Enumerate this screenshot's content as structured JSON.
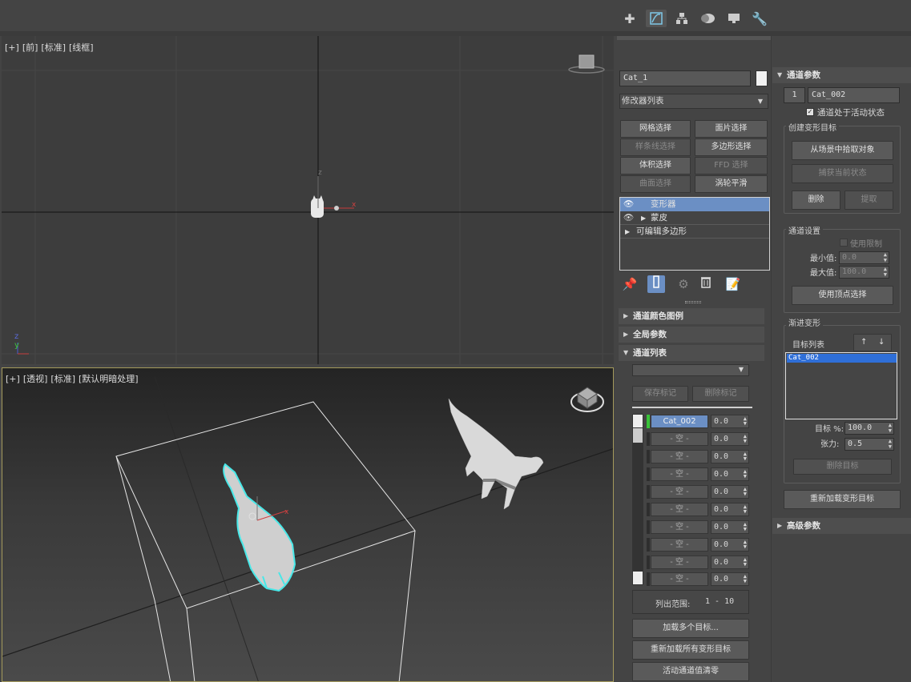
{
  "viewports": {
    "front": {
      "plus": "[+]",
      "view": "[前]",
      "shading": "[标准]",
      "display": "[线框]"
    },
    "perspective": {
      "plus": "[+]",
      "view": "[透视]",
      "shading": "[标准]",
      "display": "[默认明暗处理]"
    },
    "axis": {
      "x": "x",
      "y": "y",
      "z": "z"
    }
  },
  "cmd_panel": {
    "tabs": [
      "create-icon",
      "modify-icon",
      "hierarchy-icon",
      "motion-icon",
      "display-icon",
      "utilities-icon"
    ],
    "object_name": "Cat_1",
    "modifier_list": "修改器列表",
    "modifier_buttons": [
      {
        "label": "网格选择",
        "enabled": true
      },
      {
        "label": "面片选择",
        "enabled": true
      },
      {
        "label": "样条线选择",
        "enabled": false
      },
      {
        "label": "多边形选择",
        "enabled": true
      },
      {
        "label": "体积选择",
        "enabled": true
      },
      {
        "label": "FFD 选择",
        "enabled": false
      },
      {
        "label": "曲面选择",
        "enabled": false
      },
      {
        "label": "涡轮平滑",
        "enabled": true
      }
    ],
    "stack": [
      {
        "label": "变形器",
        "selected": true,
        "eye": true,
        "expand": false
      },
      {
        "label": "蒙皮",
        "selected": false,
        "eye": true,
        "expand": true
      },
      {
        "label": "可编辑多边形",
        "selected": false,
        "eye": false,
        "expand": true
      }
    ]
  },
  "sections": {
    "channel_color_legend": "通道颜色图例",
    "global_params": "全局参数",
    "channel_list": "通道列表",
    "channel_params": "通道参数",
    "advanced_params": "高级参数"
  },
  "channel_list": {
    "save_marker": "保存标记",
    "delete_marker": "删除标记",
    "channels": [
      {
        "name": "Cat_002",
        "value": "0.0",
        "active": true
      },
      {
        "name": "- 空 -",
        "value": "0.0",
        "active": false
      },
      {
        "name": "- 空 -",
        "value": "0.0",
        "active": false
      },
      {
        "name": "- 空 -",
        "value": "0.0",
        "active": false
      },
      {
        "name": "- 空 -",
        "value": "0.0",
        "active": false
      },
      {
        "name": "- 空 -",
        "value": "0.0",
        "active": false
      },
      {
        "name": "- 空 -",
        "value": "0.0",
        "active": false
      },
      {
        "name": "- 空 -",
        "value": "0.0",
        "active": false
      },
      {
        "name": "- 空 -",
        "value": "0.0",
        "active": false
      },
      {
        "name": "- 空 -",
        "value": "0.0",
        "active": false
      }
    ],
    "range_label": "列出范围:",
    "range_value": "1 - 10",
    "load_multiple": "加载多个目标...",
    "reload_all": "重新加载所有变形目标",
    "zero_active": "活动通道值清零"
  },
  "channel_params": {
    "channel_number": "1",
    "channel_name": "Cat_002",
    "channel_active_label": "通道处于活动状态",
    "create_target_group": "创建变形目标",
    "pick_from_scene": "从场景中拾取对象",
    "capture_state": "捕获当前状态",
    "delete": "删除",
    "extract": "提取",
    "channel_settings_group": "通道设置",
    "use_limits": "使用限制",
    "min_label": "最小值:",
    "min_value": "0.0",
    "max_label": "最大值:",
    "max_value": "100.0",
    "use_vertex_sel": "使用顶点选择",
    "progressive_group": "渐进变形",
    "target_list_label": "目标列表",
    "targets": [
      "Cat_002"
    ],
    "target_pct_label": "目标 %:",
    "target_pct_value": "100.0",
    "tension_label": "张力:",
    "tension_value": "0.5",
    "delete_target": "删除目标",
    "reload_target": "重新加载变形目标"
  },
  "colors": {
    "accent": "#6b8fc4",
    "active_channel": "#38c338",
    "selection_cyan": "#48e8e8",
    "gizmo_x": "#e04040"
  }
}
